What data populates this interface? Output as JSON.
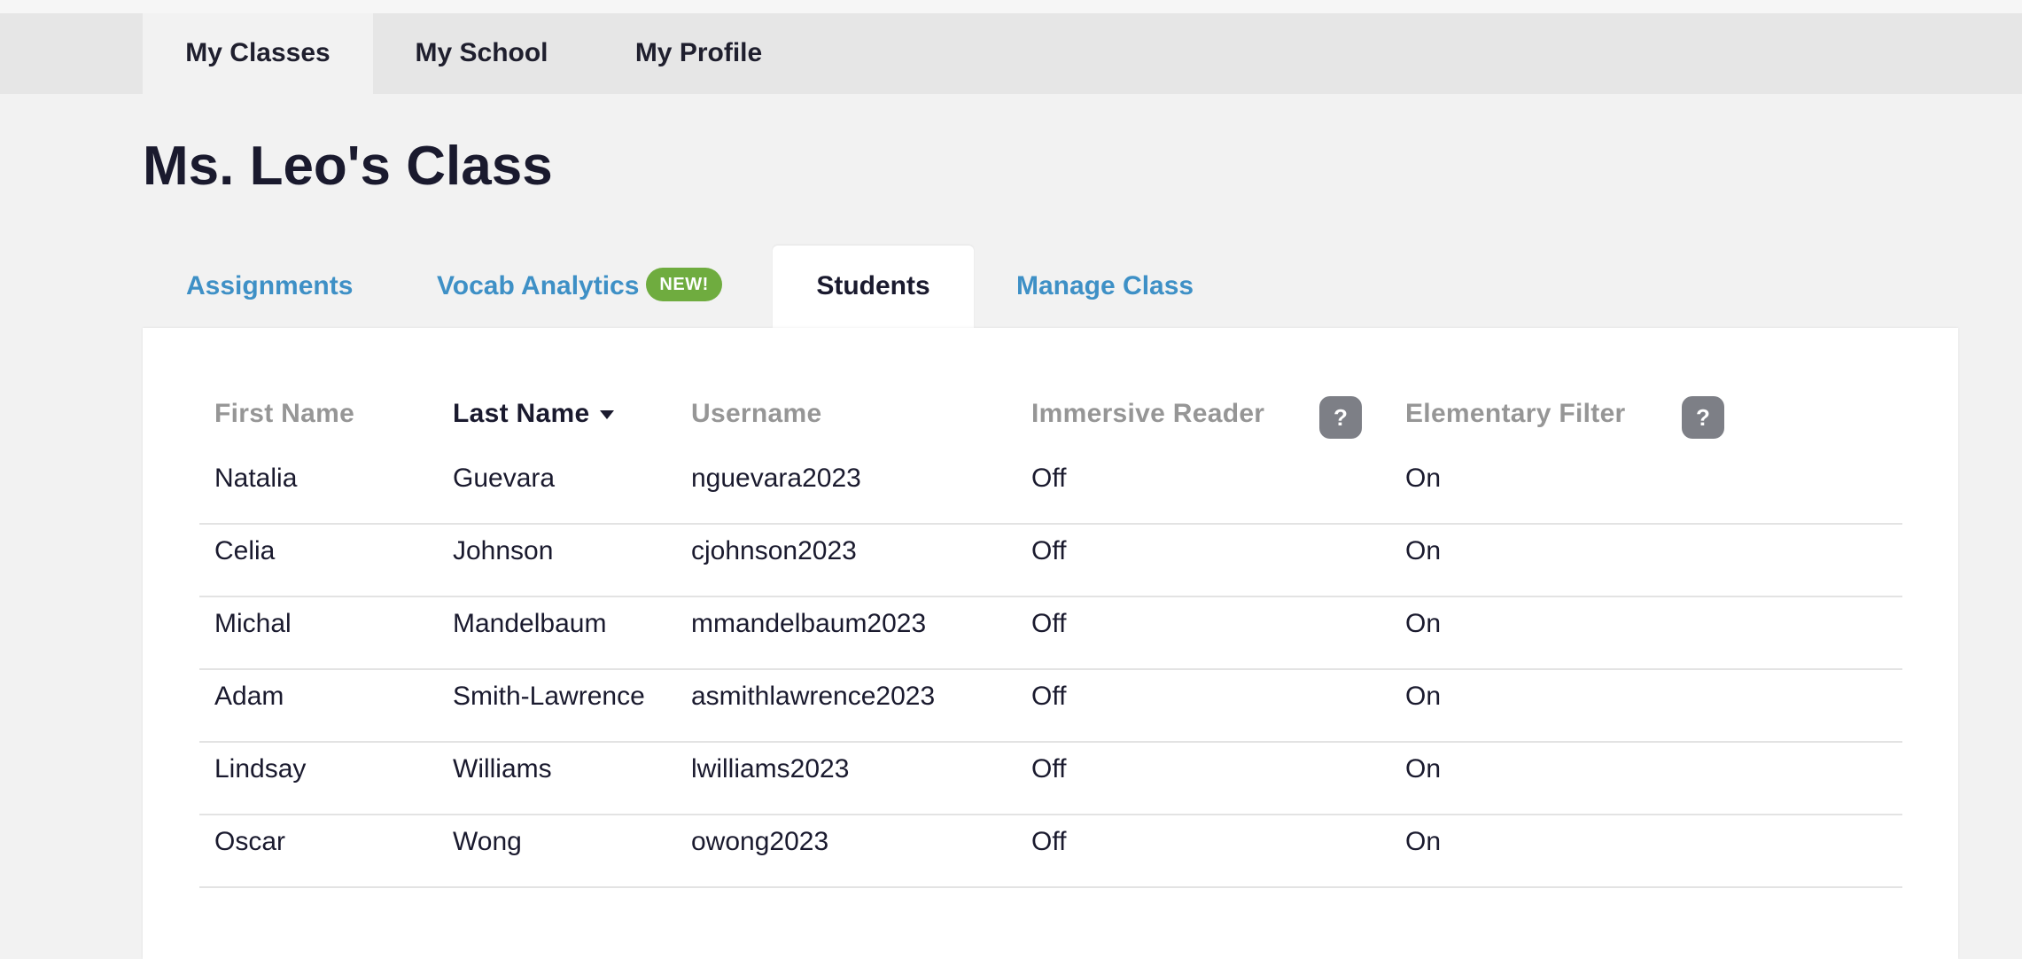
{
  "top_nav": {
    "items": [
      {
        "label": "My Classes",
        "active": true
      },
      {
        "label": "My School",
        "active": false
      },
      {
        "label": "My Profile",
        "active": false
      }
    ]
  },
  "page": {
    "title": "Ms. Leo's Class"
  },
  "sub_tabs": [
    {
      "label": "Assignments",
      "active": false
    },
    {
      "label": "Vocab Analytics",
      "badge": "NEW!",
      "active": false
    },
    {
      "label": "Students",
      "active": true
    },
    {
      "label": "Manage Class",
      "active": false
    }
  ],
  "table": {
    "headers": {
      "first_name": "First Name",
      "last_name": "Last Name",
      "username": "Username",
      "immersive_reader": "Immersive Reader",
      "elementary_filter": "Elementary Filter"
    },
    "sort_column": "last_name",
    "help_icon_glyph": "?",
    "rows": [
      {
        "first": "Natalia",
        "last": "Guevara",
        "username": "nguevara2023",
        "immersive": "Off",
        "elementary": "On"
      },
      {
        "first": "Celia",
        "last": "Johnson",
        "username": "cjohnson2023",
        "immersive": "Off",
        "elementary": "On"
      },
      {
        "first": "Michal",
        "last": "Mandelbaum",
        "username": "mmandelbaum2023",
        "immersive": "Off",
        "elementary": "On"
      },
      {
        "first": "Adam",
        "last": "Smith-Lawrence",
        "username": "asmithlawrence2023",
        "immersive": "Off",
        "elementary": "On"
      },
      {
        "first": "Lindsay",
        "last": "Williams",
        "username": "lwilliams2023",
        "immersive": "Off",
        "elementary": "On"
      },
      {
        "first": "Oscar",
        "last": "Wong",
        "username": "owong2023",
        "immersive": "Off",
        "elementary": "On"
      }
    ]
  },
  "colors": {
    "link_blue": "#3e90c6",
    "badge_green": "#6fac3f",
    "help_gray": "#7d7f86",
    "header_gray": "#969696"
  }
}
